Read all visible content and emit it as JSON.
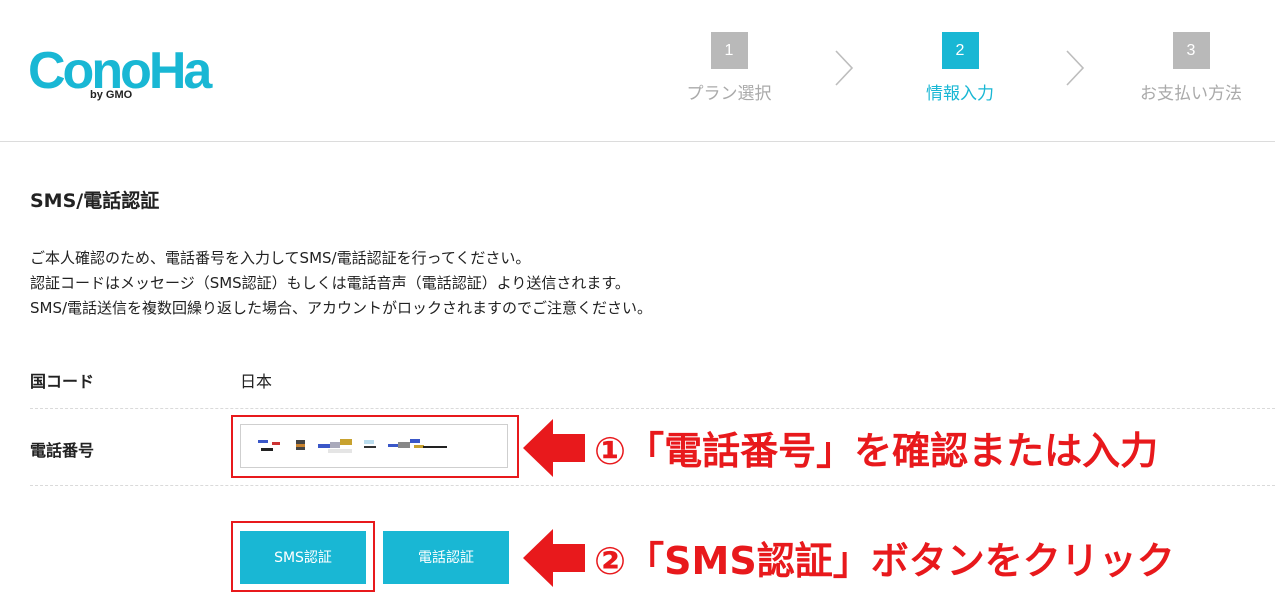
{
  "brand": {
    "logo_text": "ConoHa",
    "logo_sub": "by GMO",
    "color": "#19b7d4"
  },
  "steps": [
    {
      "number": "1",
      "label": "プラン選択",
      "active": false
    },
    {
      "number": "2",
      "label": "情報入力",
      "active": true
    },
    {
      "number": "3",
      "label": "お支払い方法",
      "active": false
    }
  ],
  "section": {
    "title": "SMS/電話認証",
    "description": [
      "ご本人確認のため、電話番号を入力してSMS/電話認証を行ってください。",
      "認証コードはメッセージ（SMS認証）もしくは電話音声（電話認証）より送信されます。",
      "SMS/電話送信を複数回繰り返した場合、アカウントがロックされますのでご注意ください。"
    ]
  },
  "form": {
    "country_label": "国コード",
    "country_value": "日本",
    "phone_label": "電話番号",
    "phone_value": ""
  },
  "buttons": {
    "sms": "SMS認証",
    "call": "電話認証"
  },
  "annotations": {
    "step1": "①「電話番号」を確認または入力",
    "step2": "②「SMS認証」ボタンをクリック",
    "color": "#e8191c"
  }
}
